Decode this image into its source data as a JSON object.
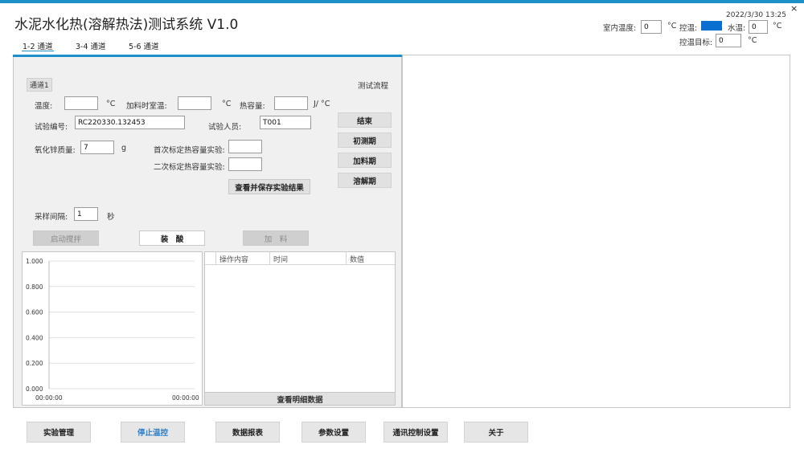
{
  "app": {
    "title": "水泥水化热(溶解热法)测试系统 V1.0",
    "close_glyph": "×",
    "datetime": "2022/3/30 13:25"
  },
  "header_controls": {
    "room_temp_label": "室内温度:",
    "room_temp_value": "0",
    "room_temp_unit": "°C",
    "temp_control_label": "控温:",
    "temp_control_color": "#0a6fd1",
    "water_temp_label": "水温:",
    "water_temp_value": "0",
    "water_temp_unit": "°C",
    "target_label": "控温目标:",
    "target_value": "0",
    "target_unit": "°C"
  },
  "tabs": [
    {
      "label": "1-2 通道"
    },
    {
      "label": "3-4 通道"
    },
    {
      "label": "5-6 通道"
    }
  ],
  "channel": {
    "name": "通道1",
    "process_link": "测试流程",
    "temp_label": "温度:",
    "temp_value": "",
    "temp_unit": "°C",
    "feed_temp_label": "加料时室温:",
    "feed_temp_value": "",
    "feed_temp_unit": "°C",
    "heat_cap_label": "热容量:",
    "heat_cap_value": "",
    "heat_cap_unit": "J/ °C",
    "test_no_label": "试验编号:",
    "test_no_value": "RC220330.132453",
    "tester_label": "试验人员:",
    "tester_value": "T001",
    "zno_label": "氧化锌质量:",
    "zno_value": "7",
    "zno_unit": "g",
    "first_cal_label": "首次标定热容量实验:",
    "first_cal_value": "",
    "second_cal_label": "二次标定热容量实验:",
    "second_cal_value": "",
    "view_save_button": "查看并保存实验结果",
    "interval_label": "采样间隔:",
    "interval_value": "1",
    "interval_unit": "秒"
  },
  "phase_buttons": {
    "end": "结束",
    "initial": "初测期",
    "feeding": "加料期",
    "dissolve": "溶解期"
  },
  "action_buttons": {
    "start_stir": "启动搅拌",
    "load_acid": "装　酸",
    "add_material": "加　料"
  },
  "chart_data": {
    "type": "line",
    "y_ticks": [
      "1.000",
      "0.800",
      "0.600",
      "0.400",
      "0.200",
      "0.000"
    ],
    "ylim": [
      0,
      1
    ],
    "x_ticks": [
      "00:00:00",
      "00:00:00"
    ],
    "series": [],
    "grid": true
  },
  "log_table": {
    "columns": [
      "操作内容",
      "时间",
      "数值"
    ],
    "rows": [],
    "detail_button": "查看明细数据"
  },
  "bottom_buttons": [
    {
      "label": "实验管理"
    },
    {
      "label": "停止温控"
    },
    {
      "label": "数据报表"
    },
    {
      "label": "参数设置"
    },
    {
      "label": "通讯控制设置"
    },
    {
      "label": "关于"
    }
  ]
}
